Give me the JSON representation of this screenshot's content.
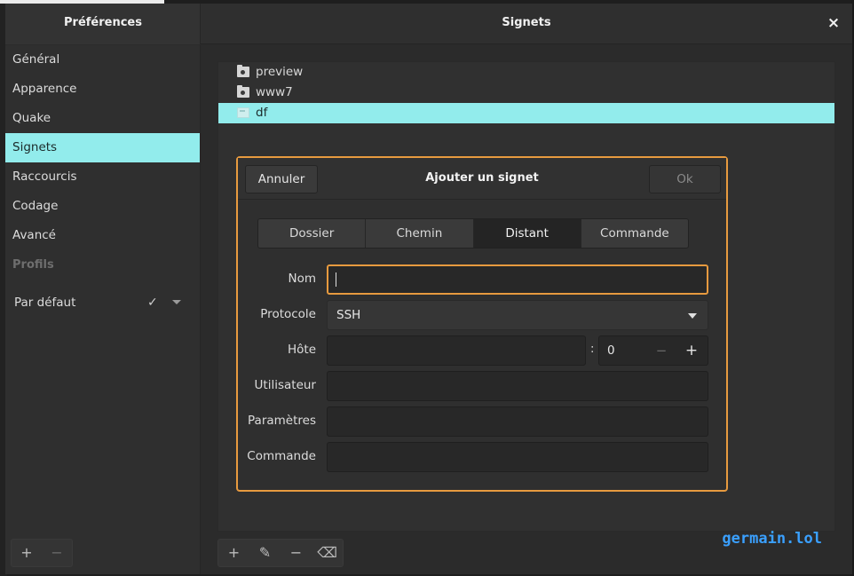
{
  "sidebar": {
    "title": "Préférences",
    "items": [
      {
        "label": "Général"
      },
      {
        "label": "Apparence"
      },
      {
        "label": "Quake"
      },
      {
        "label": "Signets"
      },
      {
        "label": "Raccourcis"
      },
      {
        "label": "Codage"
      },
      {
        "label": "Avancé"
      }
    ],
    "active_item": "Signets",
    "profiles_heading": "Profils",
    "profiles": [
      {
        "label": "Par défaut",
        "checked": true
      }
    ],
    "toolbar": {
      "add_symbol": "+",
      "remove_symbol": "−"
    }
  },
  "main": {
    "title": "Signets",
    "close_symbol": "×",
    "bookmarks": [
      {
        "label": "preview",
        "icon": "folder-icon"
      },
      {
        "label": "www7",
        "icon": "folder-icon"
      },
      {
        "label": "df",
        "icon": "terminal-icon",
        "selected": true
      }
    ],
    "toolbar": {
      "add_symbol": "+",
      "edit_symbol": "✎",
      "remove_symbol": "−",
      "clear_symbol": "⌫"
    },
    "watermark": "germain.lol"
  },
  "dialog": {
    "title": "Ajouter un signet",
    "cancel_label": "Annuler",
    "ok_label": "Ok",
    "tabs": [
      {
        "label": "Dossier"
      },
      {
        "label": "Chemin"
      },
      {
        "label": "Distant"
      },
      {
        "label": "Commande"
      }
    ],
    "active_tab": "Distant",
    "form": {
      "name_label": "Nom",
      "name_value": "",
      "protocol_label": "Protocole",
      "protocol_value": "SSH",
      "host_label": "Hôte",
      "host_value": "",
      "port_separator": ":",
      "port_value": "0",
      "port_minus": "−",
      "port_plus": "+",
      "user_label": "Utilisateur",
      "user_value": "",
      "params_label": "Paramètres",
      "params_value": "",
      "command_label": "Commande",
      "command_value": ""
    }
  },
  "colors": {
    "accent_selection": "#92ecec",
    "focus_border": "#e79a3f",
    "watermark": "#3aa0ff"
  }
}
